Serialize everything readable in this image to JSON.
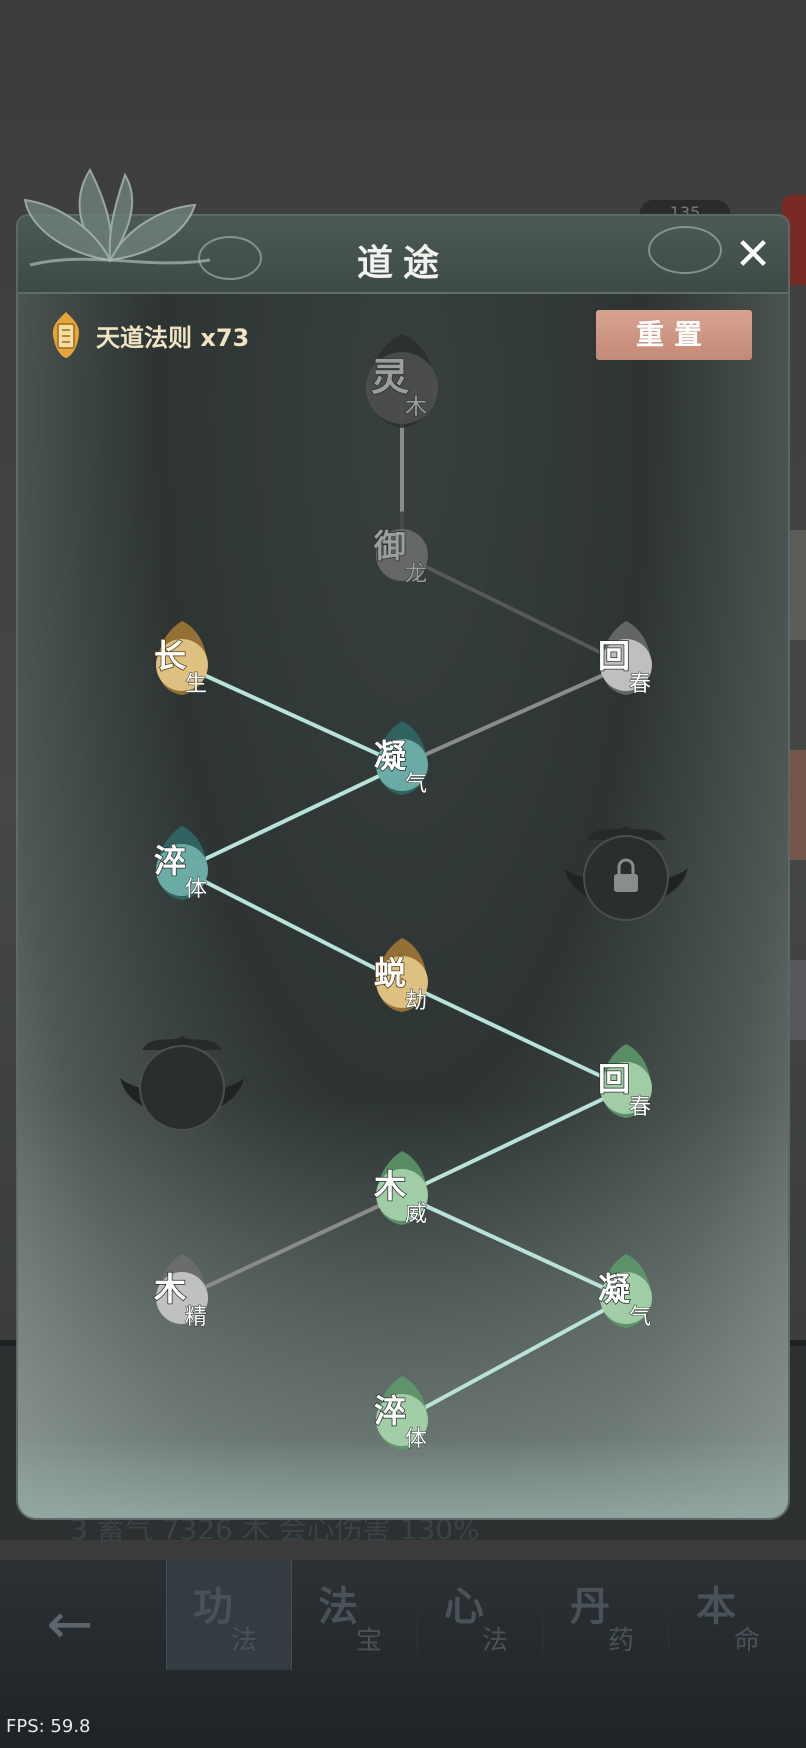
{
  "background": {
    "behind_badge": "135",
    "behind_text": "3 蓄气 7326   木 会心伤害 130%"
  },
  "modal": {
    "title": "道途",
    "close_icon": "close-icon",
    "currency": {
      "label": "天道法则 x73",
      "icon": "heaven-rule-scroll-icon"
    },
    "reset_label": "重置"
  },
  "skill_nodes": [
    {
      "id": "n1",
      "main": "灵",
      "sub": "木",
      "state": "locked-dark"
    },
    {
      "id": "n2",
      "main": "御",
      "sub": "龙",
      "state": "locked"
    },
    {
      "id": "n3",
      "main": "长",
      "sub": "生",
      "state": "gold"
    },
    {
      "id": "n4",
      "main": "回",
      "sub": "春",
      "state": "grey"
    },
    {
      "id": "n5",
      "main": "凝",
      "sub": "气",
      "state": "teal"
    },
    {
      "id": "n6",
      "main": "淬",
      "sub": "体",
      "state": "teal"
    },
    {
      "id": "n7",
      "main": "",
      "sub": "",
      "state": "padlock",
      "icon": "padlock-icon"
    },
    {
      "id": "n8",
      "main": "蜕",
      "sub": "劫",
      "state": "gold"
    },
    {
      "id": "n9",
      "main": "",
      "sub": "",
      "state": "empty-lotus"
    },
    {
      "id": "n10",
      "main": "回",
      "sub": "春",
      "state": "green"
    },
    {
      "id": "n11",
      "main": "木",
      "sub": "威",
      "state": "green"
    },
    {
      "id": "n12",
      "main": "木",
      "sub": "精",
      "state": "grey"
    },
    {
      "id": "n13",
      "main": "凝",
      "sub": "气",
      "state": "green"
    },
    {
      "id": "n14",
      "main": "淬",
      "sub": "体",
      "state": "green"
    }
  ],
  "bottom_nav": {
    "back_icon": "back-arrow-icon",
    "tabs": [
      {
        "main": "功",
        "sub": "法",
        "active": true
      },
      {
        "main": "法",
        "sub": "宝",
        "active": false
      },
      {
        "main": "心",
        "sub": "法",
        "active": false
      },
      {
        "main": "丹",
        "sub": "药",
        "active": false
      },
      {
        "main": "本",
        "sub": "命",
        "active": false
      }
    ]
  },
  "fps": "FPS: 59.8",
  "colors": {
    "gold": "#d9b574",
    "teal": "#5fa7a2",
    "green": "#8fc29a",
    "grey": "#9c9d9b",
    "active_line": "#b9e3d8",
    "inactive_line": "#8a8c8b",
    "reset_button": "#d29a88"
  }
}
